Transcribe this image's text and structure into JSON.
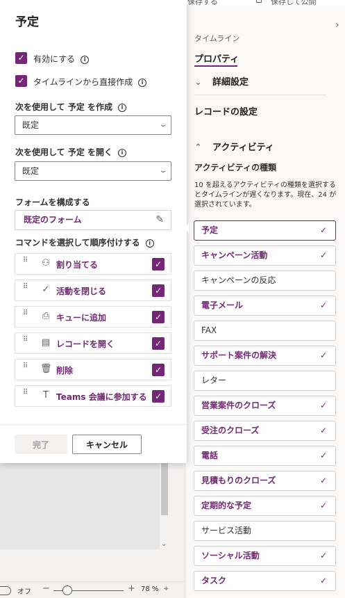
{
  "top_bar": {
    "save_copy": "ーを保存する",
    "save_publish": "保存して公開"
  },
  "right_panel": {
    "timeline_label": "タイムライン",
    "properties_tab": "プロパティ",
    "advanced_settings": "詳細設定",
    "record_settings": "レコードの設定",
    "activities": "アクティビティ",
    "activity_types_label": "アクティビティの種類",
    "activity_help": "10 を超えるアクティビティの種類を選択するとタイムラインが遅くなります。現在、24 が選択されています。",
    "activity_items": [
      {
        "label": "予定",
        "checked": true,
        "selected": true
      },
      {
        "label": "キャンペーン活動",
        "checked": true
      },
      {
        "label": "キャンペーンの反応",
        "checked": false
      },
      {
        "label": "電子メール",
        "checked": true
      },
      {
        "label": "FAX",
        "checked": false
      },
      {
        "label": "サポート案件の解決",
        "checked": true
      },
      {
        "label": "レター",
        "checked": false
      },
      {
        "label": "営業案件のクローズ",
        "checked": true
      },
      {
        "label": "受注のクローズ",
        "checked": true
      },
      {
        "label": "電話",
        "checked": true
      },
      {
        "label": "見積もりのクローズ",
        "checked": true
      },
      {
        "label": "定期的な予定",
        "checked": true
      },
      {
        "label": "サービス活動",
        "checked": false
      },
      {
        "label": "ソーシャル活動",
        "checked": true
      },
      {
        "label": "タスク",
        "checked": true
      }
    ]
  },
  "dialog": {
    "title": "予定",
    "enabled_label": "有効にする",
    "create_from_timeline_label": "タイムラインから直接作成",
    "create_using_label": "次を使用して 予定 を作成",
    "create_using_value": "既定",
    "open_using_label": "次を使用して 予定 を開く",
    "open_using_value": "既定",
    "configure_form_label": "フォームを構成する",
    "default_form": "既定のフォーム",
    "commands_label": "コマンドを選択して順序付けする",
    "commands": [
      {
        "label": "割り当てる",
        "icon": "assign-person-icon",
        "checked": true
      },
      {
        "label": "活動を閉じる",
        "icon": "checkmark-icon",
        "checked": true
      },
      {
        "label": "キューに追加",
        "icon": "queue-icon",
        "checked": true
      },
      {
        "label": "レコードを開く",
        "icon": "open-record-icon",
        "checked": true
      },
      {
        "label": "削除",
        "icon": "trash-icon",
        "checked": true
      },
      {
        "label": "Teams 会議に参加する",
        "icon": "teams-icon",
        "checked": true
      }
    ],
    "done_button": "完了",
    "cancel_button": "キャンセル"
  },
  "status_bar": {
    "toggle_label": "オフ",
    "zoom": "78 %",
    "zoom_level": 0.2
  },
  "colors": {
    "accent": "#742774",
    "border": "#d2d0ce"
  }
}
